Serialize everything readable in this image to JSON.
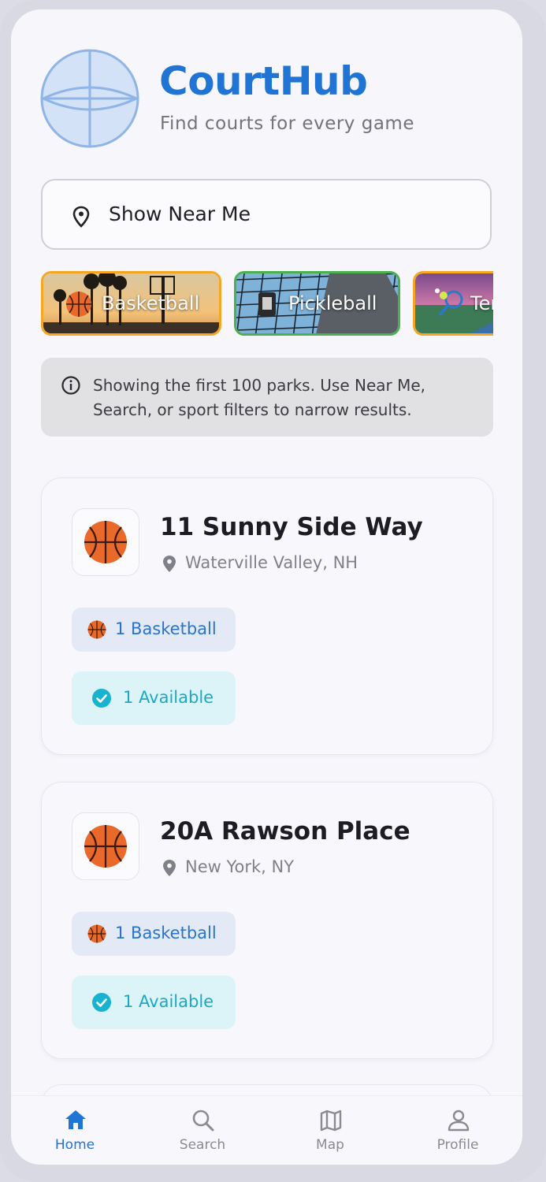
{
  "app": {
    "title": "CourtHub",
    "subtitle": "Find courts for every game",
    "accent_color": "#1f74d4"
  },
  "near_me": {
    "label": "Show Near Me",
    "icon": "location-pin-icon"
  },
  "sport_filters": [
    {
      "label": "Basketball",
      "border_color": "#f5a623"
    },
    {
      "label": "Pickleball",
      "border_color": "#4caf50"
    },
    {
      "label": "Tennis",
      "border_color": "#f5a623"
    }
  ],
  "info_banner": {
    "icon": "info-icon",
    "text": "Showing the first 100 parks. Use Near Me, Search, or sport filters to narrow results."
  },
  "parks": [
    {
      "name": "11 Sunny Side Way",
      "location": "Waterville Valley, NH",
      "sport_badge": "1 Basketball",
      "availability": "1 Available"
    },
    {
      "name": "20A Rawson Place",
      "location": "New York, NY",
      "sport_badge": "1 Basketball",
      "availability": "1 Available"
    }
  ],
  "bottom_nav": [
    {
      "label": "Home",
      "icon": "home-icon",
      "active": true
    },
    {
      "label": "Search",
      "icon": "search-icon",
      "active": false
    },
    {
      "label": "Map",
      "icon": "map-icon",
      "active": false
    },
    {
      "label": "Profile",
      "icon": "profile-icon",
      "active": false
    }
  ]
}
